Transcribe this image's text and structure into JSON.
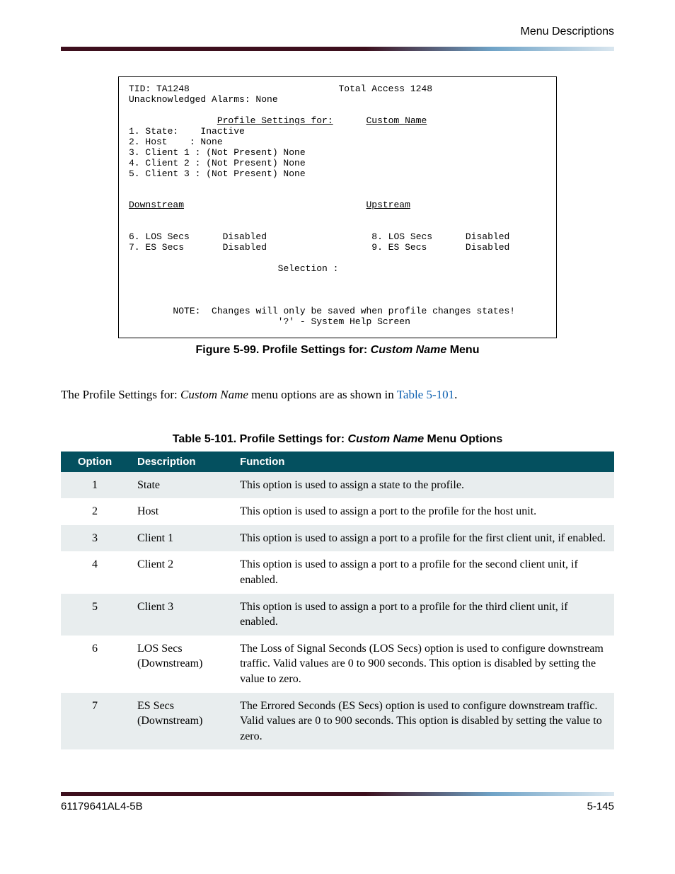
{
  "header": {
    "section": "Menu Descriptions"
  },
  "terminal": {
    "tid": "TID: TA1248",
    "device": "Total Access 1248",
    "alarms": "Unacknowledged Alarms: None",
    "settings_for": "Profile Settings for:",
    "custom": "Custom Name",
    "lines": {
      "l1": "1. State:    Inactive",
      "l2": "2. Host    : None",
      "l3": "3. Client 1 : (Not Present) None",
      "l4": "4. Client 2 : (Not Present) None",
      "l5": "5. Client 3 : (Not Present) None"
    },
    "down_hdr": "Downstream",
    "up_hdr": "Upstream",
    "ds_a": "6. LOS Secs      Disabled",
    "us_a": "8. LOS Secs      Disabled",
    "ds_b": "7. ES Secs       Disabled",
    "us_b": "9. ES Secs       Disabled",
    "selection": "Selection :",
    "note": "NOTE:  Changes will only be saved when profile changes states!",
    "help": "'?' - System Help Screen"
  },
  "figure": {
    "label_a": "Figure 5-99.  Profile Settings for: ",
    "label_b": "Custom Name",
    "label_c": " Menu"
  },
  "paragraph": {
    "a": "The Profile Settings for: ",
    "b": "Custom Name",
    "c": " menu options are as shown in ",
    "link": "Table 5-101",
    "d": "."
  },
  "table": {
    "caption_a": "Table 5-101.  Profile Settings for: ",
    "caption_b": "Custom Name",
    "caption_c": " Menu Options",
    "headers": {
      "c1": "Option",
      "c2": "Description",
      "c3": "Function"
    },
    "rows": [
      {
        "opt": "1",
        "desc": "State",
        "fn": "This option is used to assign a state to the profile."
      },
      {
        "opt": "2",
        "desc": "Host",
        "fn": "This option is used to assign a port to the profile for the host unit."
      },
      {
        "opt": "3",
        "desc": "Client 1",
        "fn": "This option is used to assign a port to a profile for the first client unit, if enabled."
      },
      {
        "opt": "4",
        "desc": "Client 2",
        "fn": "This option is used to assign a port to a profile for the second client unit, if enabled."
      },
      {
        "opt": "5",
        "desc": "Client 3",
        "fn": "This option is used to assign a port to a profile for the third client unit, if enabled."
      },
      {
        "opt": "6",
        "desc": "LOS Secs (Downstream)",
        "fn": "The Loss of Signal Seconds (LOS Secs) option is used to configure downstream traffic. Valid values are 0 to 900 seconds. This option is disabled by setting the value to zero."
      },
      {
        "opt": "7",
        "desc": "ES Secs (Downstream)",
        "fn": "The Errored Seconds (ES Secs) option is used to configure downstream traffic. Valid values are 0 to 900 seconds. This option is disabled by setting the value to zero."
      }
    ]
  },
  "footer": {
    "left": "61179641AL4-5B",
    "right": "5-145"
  }
}
